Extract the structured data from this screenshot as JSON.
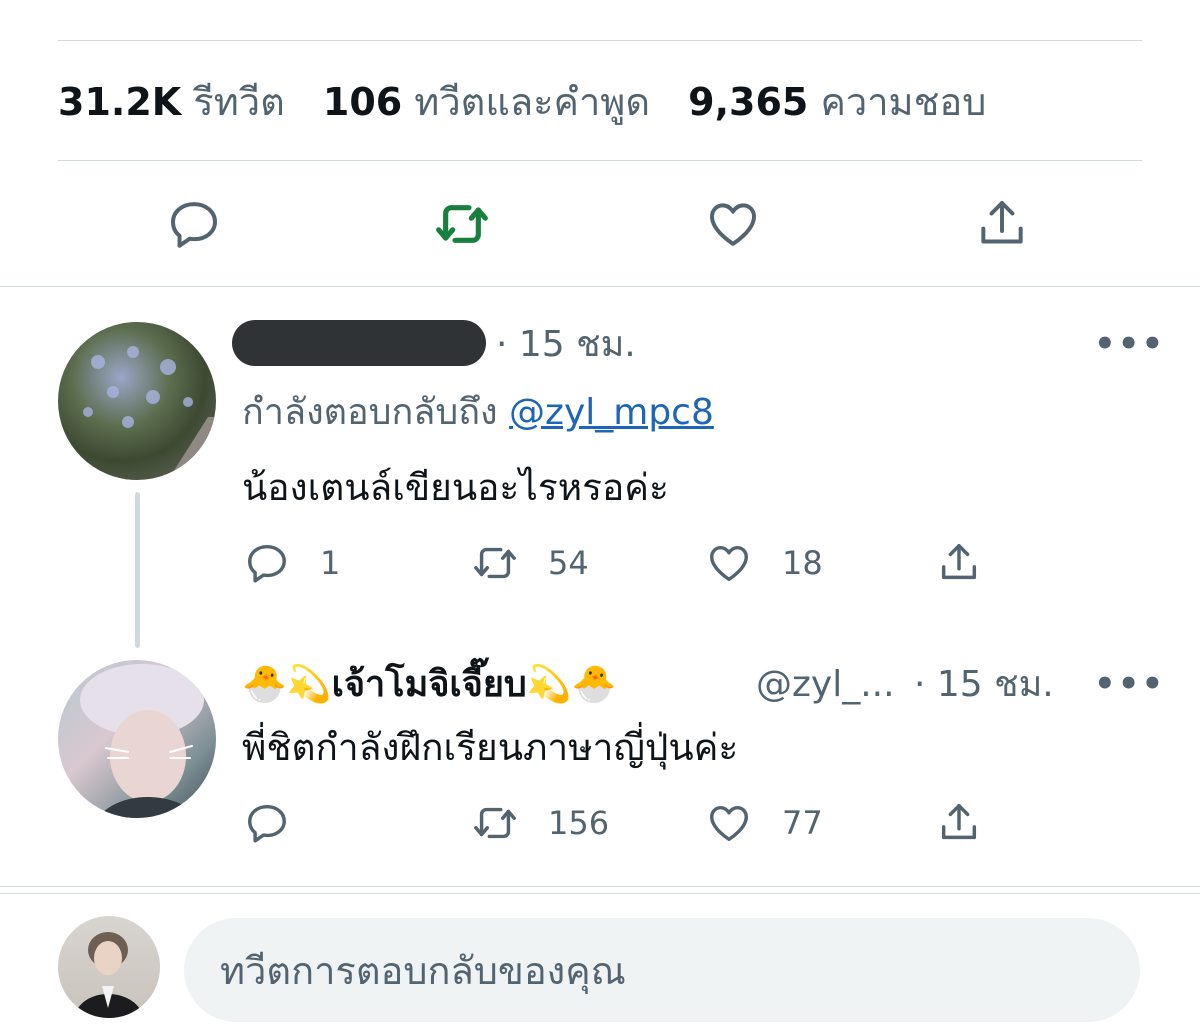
{
  "stats": {
    "retweets_count": "31.2K",
    "retweets_label": "รีทวีต",
    "quotes_count": "106",
    "quotes_label": "ทวีตและคำพูด",
    "likes_count": "9,365",
    "likes_label": "ความชอบ"
  },
  "action_bar": {
    "icons": [
      "reply-icon",
      "retweet-icon",
      "like-icon",
      "share-icon"
    ],
    "retweet_active_color": "#17803d"
  },
  "replies": [
    {
      "display_name_redacted": true,
      "time": "· 15 ชม.",
      "more": "•••",
      "replying_to_label": "กำลังตอบกลับถึง",
      "replying_to_handle": "@zyl_mpc8",
      "text": "น้องเตนล์เขียนอะไรหรอค่ะ",
      "reply_count": "1",
      "retweet_count": "54",
      "like_count": "18"
    },
    {
      "display_name": "🐣💫เจ้าโมจิเจี๊ยบ💫🐣",
      "handle": "@zyl_...",
      "time": "· 15 ชม.",
      "more": "•••",
      "text": "พี่ชิตกำลังฝึกเรียนภาษาญี่ปุ่นค่ะ",
      "reply_count": "",
      "retweet_count": "156",
      "like_count": "77"
    }
  ],
  "composer": {
    "placeholder": "ทวีตการตอบกลับของคุณ"
  },
  "colors": {
    "secondary_text": "#536471",
    "link": "#1d65b6",
    "divider": "#cfd9de",
    "composer_bg": "#eff3f4"
  }
}
